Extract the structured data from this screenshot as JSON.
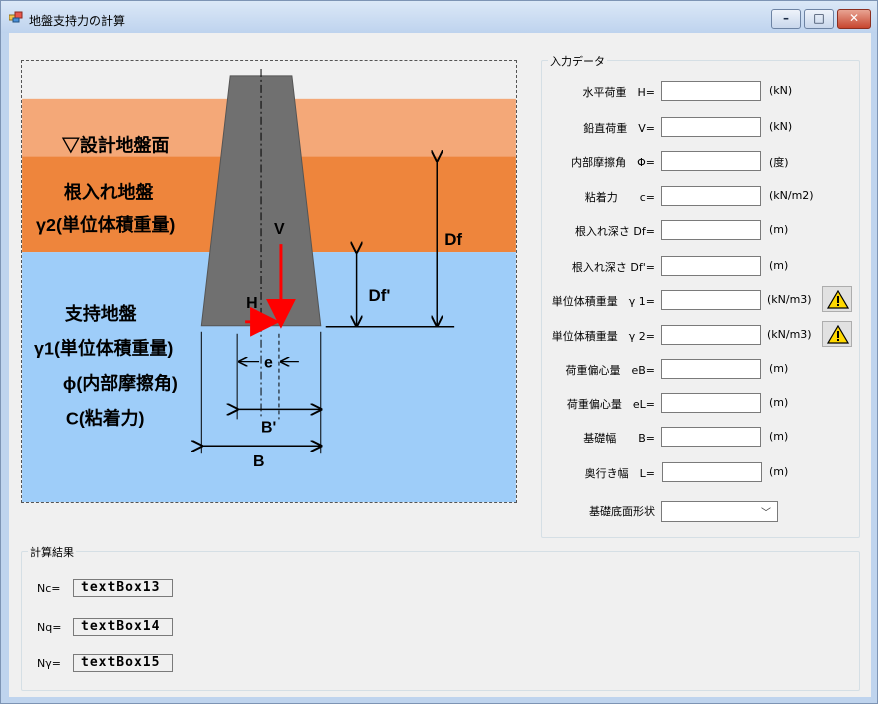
{
  "window": {
    "title": "地盤支持力の計算",
    "min_glyph": "–",
    "max_glyph": "□",
    "close_glyph": "✕"
  },
  "diagram": {
    "ground_surface": "▽設計地盤面",
    "embedment_layer": "根入れ地盤",
    "gamma2_label": "γ2(単位体積重量)",
    "bearing_layer": "支持地盤",
    "gamma1_label": "γ1(単位体積重量)",
    "phi_label": "ϕ(内部摩擦角)",
    "c_label": "C(粘着力)",
    "v_label": "V",
    "h_label": "H",
    "df_label": "Df",
    "dfp_label": "Df'",
    "e_label": "e",
    "bp_label": "B'",
    "b_label": "B",
    "colors": {
      "surface_band": "#f4a878",
      "embedment_band": "#ee853c",
      "bearing_band": "#9ecdf9",
      "footing": "#707070",
      "load_arrow": "#ff0000"
    }
  },
  "input": {
    "group_title": "入力データ",
    "rows": [
      {
        "label": "水平荷重　H=",
        "unit": "(kN)"
      },
      {
        "label": "鉛直荷重　V=",
        "unit": "(kN)"
      },
      {
        "label": "内部摩擦角　Φ=",
        "unit": "(度)"
      },
      {
        "label": "粘着力　　c=",
        "unit": "(kN/m2)"
      },
      {
        "label": "根入れ深さ Df=",
        "unit": "(m)"
      },
      {
        "label": "根入れ深さ Df'=",
        "unit": "(m)"
      },
      {
        "label": "単位体積重量　γ 1=",
        "unit": "(kN/m3)"
      },
      {
        "label": "単位体積重量　γ 2=",
        "unit": "(kN/m3)"
      },
      {
        "label": "荷重偏心量　eB=",
        "unit": "(m)"
      },
      {
        "label": "荷重偏心量　eL=",
        "unit": "(m)"
      },
      {
        "label": "基礎幅　　B=",
        "unit": "(m)"
      },
      {
        "label": "奥行き幅　L=",
        "unit": "(m)"
      }
    ],
    "shape_label": "基礎底面形状",
    "shape_value": "",
    "dropdown_glyph": "﹀",
    "warn_icon": "warning-icon"
  },
  "results": {
    "group_title": "計算結果",
    "rows": [
      {
        "label": "Nc=",
        "value": "textBox13"
      },
      {
        "label": "Nq=",
        "value": "textBox14"
      },
      {
        "label": "Nγ=",
        "value": "textBox15"
      }
    ]
  }
}
